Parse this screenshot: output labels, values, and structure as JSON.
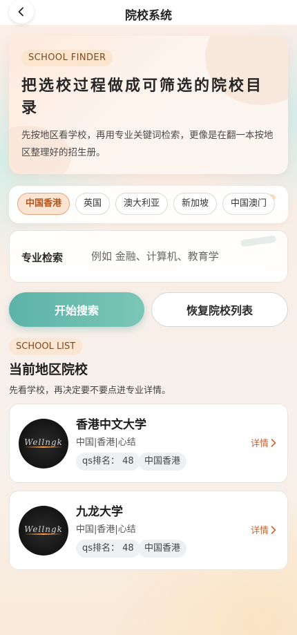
{
  "nav": {
    "title": "院校系统",
    "back_icon": "chevron-left-icon"
  },
  "hero": {
    "tag": "SCHOOL FINDER",
    "title": "把选校过程做成可筛选的院校目录",
    "description": "先按地区看学校，再用专业关键词检索，更像是在翻一本按地区整理好的招生册。"
  },
  "regions": [
    {
      "label": "中国香港",
      "active": true
    },
    {
      "label": "英国",
      "active": false
    },
    {
      "label": "澳大利亚",
      "active": false
    },
    {
      "label": "新加坡",
      "active": false
    },
    {
      "label": "中国澳门",
      "active": false
    }
  ],
  "search": {
    "label": "专业检索",
    "placeholder": "例如 金融、计算机、教育学"
  },
  "actions": {
    "search_label": "开始搜索",
    "reset_label": "恢复院校列表"
  },
  "list": {
    "tag": "SCHOOL LIST",
    "title": "当前地区院校",
    "subtitle": "先看学校，再决定要不要点进专业详情。"
  },
  "schools": [
    {
      "name": "香港中文大学",
      "meta": "中国|香港|心结",
      "qs": "qs排名： 48",
      "region": "中国香港",
      "detail": "详情",
      "logo_text": "Wellngk"
    },
    {
      "name": "九龙大学",
      "meta": "中国|香港|心结",
      "qs": "qs排名： 48",
      "region": "中国香港",
      "detail": "详情",
      "logo_text": "Wellngk"
    }
  ],
  "colors": {
    "accent": "#5cb3a8",
    "chip_active": "#b2541e",
    "link": "#d2622a"
  }
}
